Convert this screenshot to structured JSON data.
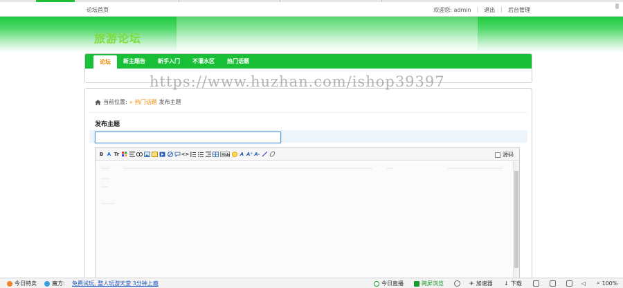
{
  "topbar": {
    "home_link": "论坛首页",
    "welcome": "欢迎您: admin",
    "logout": "退出",
    "admin": "后台管理"
  },
  "header": {
    "site_title": "旅游论坛"
  },
  "nav": {
    "items": [
      "论坛",
      "新主题告",
      "新手入门",
      "不灌水区",
      "热门话题"
    ]
  },
  "watermark": "https://www.huzhan.com/ishop39397",
  "breadcrumb": {
    "prefix": "当前位置:",
    "arrow": "»",
    "section": "热门话题",
    "current": "发布主题"
  },
  "form": {
    "heading": "发布主题",
    "subject_value": "",
    "source_label": "源码"
  },
  "toolbar": {
    "buttons": [
      "B",
      "bold-icon",
      "Tr",
      "color-icon",
      "align-icon",
      "link-icon",
      "image-icon",
      "flash-icon",
      "media-icon",
      "no-icon",
      "quote-icon",
      "code-icon",
      "ol-icon",
      "ul-icon",
      "indent-icon",
      "table-icon",
      "hide-icon",
      "smile-icon",
      "font-icon",
      "size-icon",
      "font2-icon",
      "pen-icon",
      "clip-icon"
    ]
  },
  "statusbar": {
    "deals": "今日特卖",
    "magic": "魔方:",
    "promo": "免费试玩, 整人玩游天堂 3分钟上瘾",
    "live": "今日直播",
    "screen": "跨屏浏览",
    "speed": "加速器",
    "download": "下载",
    "zoom": "100%"
  },
  "colors": {
    "brand_green": "#18bf37",
    "accent_orange": "#f08a00",
    "input_border": "#5b9bd5"
  }
}
